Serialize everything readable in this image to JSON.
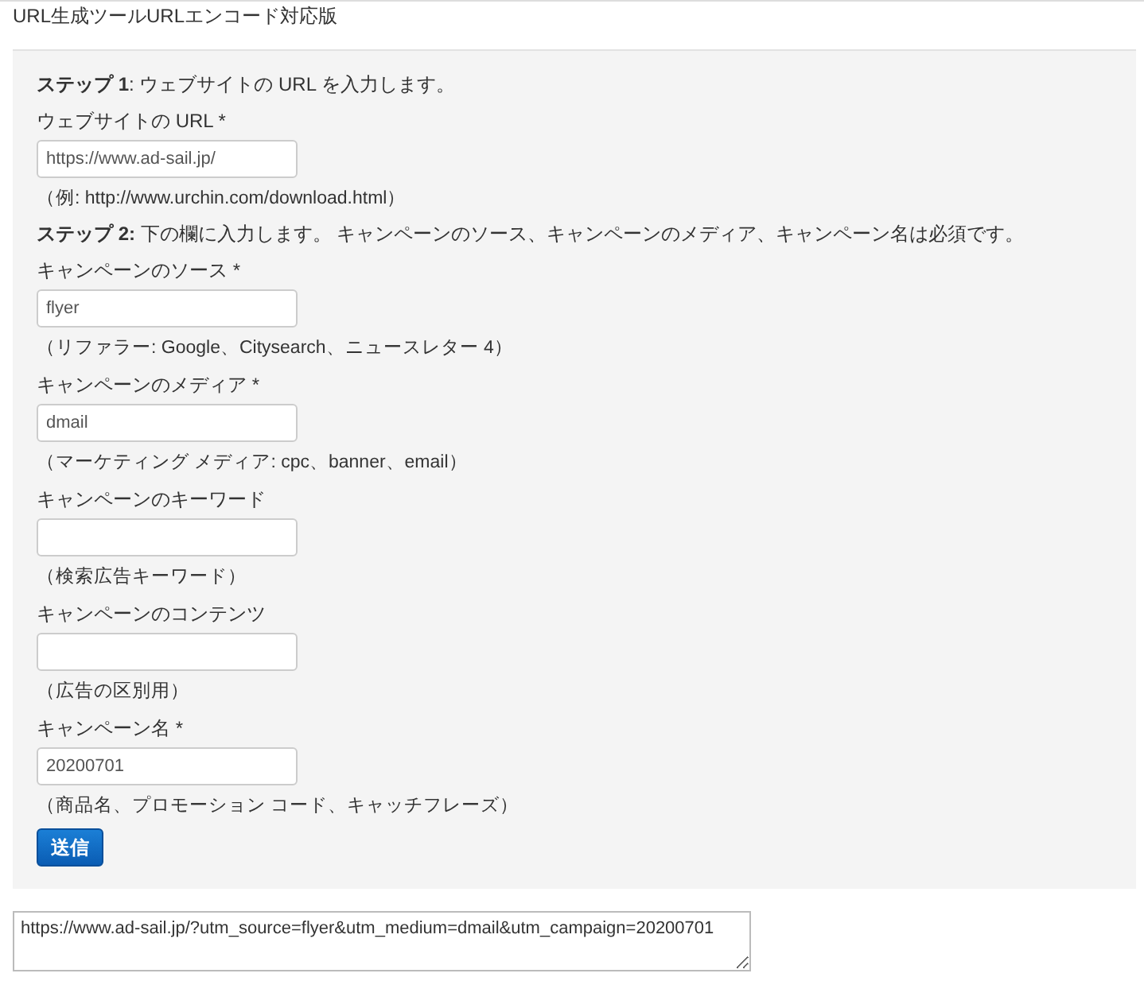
{
  "page_title": "URL生成ツールURLエンコード対応版",
  "step_1": "**ステップ 1**: ウェブサイトの URL を入力します。",
  "url_field": {
    "label": "ウェブサイトの URL *",
    "value": "https://www.ad-sail.jp/",
    "hint": "（例: http://www.urchin.com/download.html）"
  },
  "step_2": "**ステップ 2:** 下の欄に入力します。 キャンペーンのソース、キャンペーンのメディア、キャンペーン名は必須です。",
  "campaign_fields": [
    {
      "label": "キャンペーンのソース *",
      "value": "flyer",
      "hint": "（リファラー: Google、Citysearch、ニュースレター 4）"
    },
    {
      "label": "キャンペーンのメディア *",
      "value": "dmail",
      "hint": "（マーケティング メディア: cpc、banner、email）"
    },
    {
      "label": "キャンペーンのキーワード",
      "hint": "（検索広告キーワード）"
    },
    {
      "label": "キャンペーンのコンテンツ",
      "hint": "（広告の区別用）"
    },
    {
      "label": "キャンペーン名 *",
      "value": "20200701",
      "hint": "（商品名、プロモーション コード、キャッチフレーズ）"
    }
  ],
  "submit_button": "送信",
  "result": "https://www.ad-sail.jp/?utm_source=flyer&utm_medium=dmail&utm_campaign=20200701"
}
